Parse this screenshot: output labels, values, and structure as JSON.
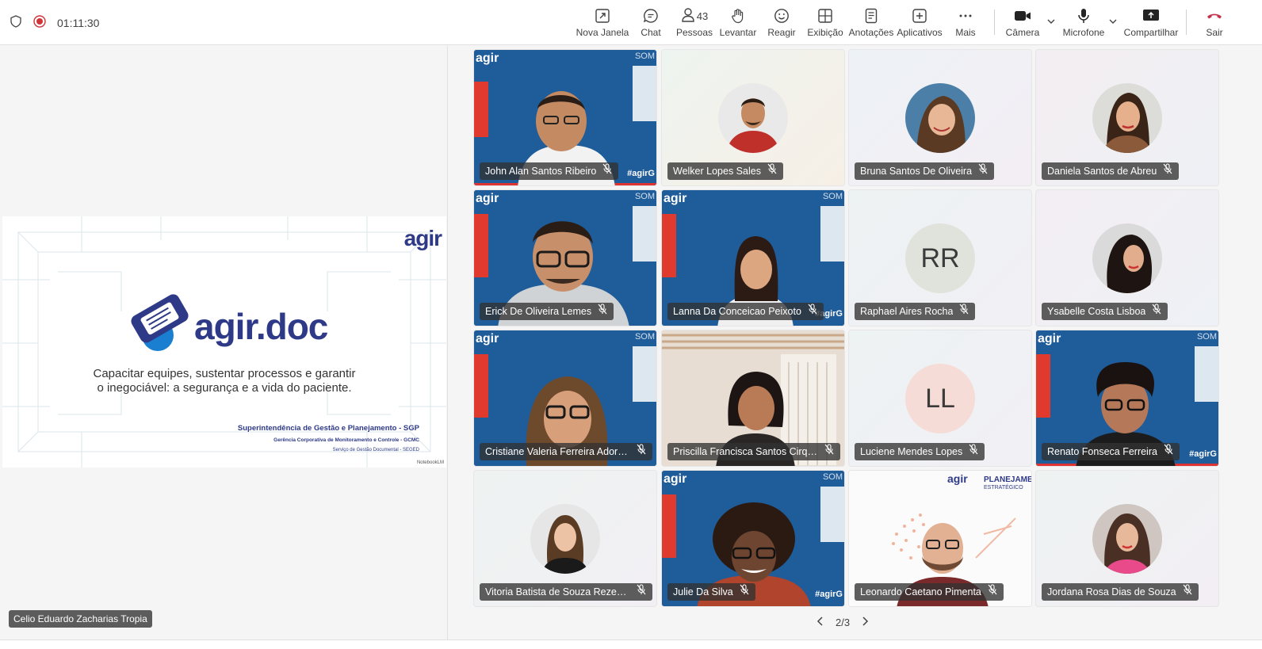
{
  "topbar": {
    "timer": "01:11:30",
    "buttons": {
      "nova_janela": "Nova Janela",
      "chat": "Chat",
      "pessoas": "Pessoas",
      "pessoas_count": "43",
      "levantar": "Levantar",
      "reagir": "Reagir",
      "exibicao": "Exibição",
      "anotacoes": "Anotações",
      "aplicativos": "Aplicativos",
      "mais": "Mais",
      "camera": "Câmera",
      "microfone": "Microfone",
      "compartilhar": "Compartilhar",
      "sair": "Sair"
    },
    "colors": {
      "leave": "#c4314b",
      "record": "#d13438"
    }
  },
  "slide": {
    "logo_small": "agir",
    "logo_big": "agir.doc",
    "tagline_1": "Capacitar equipes, sustentar processos e garantir",
    "tagline_2": "o inegociável: a segurança e a vida do paciente.",
    "org_1": "Superintendência de Gestão e Planejamento - SGP",
    "org_2": "Gerência Corporativa de Monitoramento e Controle - GCMC",
    "org_3": "Serviço de Gestão Documental - SEGED",
    "watermark": "NotebookLM",
    "colors": {
      "navy": "#2e3a87",
      "blue": "#1b7fd1"
    }
  },
  "presenter": "Celio Eduardo Zacharias Tropia",
  "participants": [
    {
      "name": "John Alan Santos Ribeiro",
      "kind": "video"
    },
    {
      "name": "Welker Lopes Sales",
      "kind": "photo"
    },
    {
      "name": "Bruna Santos De Oliveira",
      "kind": "photo"
    },
    {
      "name": "Daniela Santos de Abreu",
      "kind": "photo"
    },
    {
      "name": "Erick De Oliveira Lemes",
      "kind": "video"
    },
    {
      "name": "Lanna Da Conceicao Peixoto",
      "kind": "video"
    },
    {
      "name": "Raphael Aires Rocha",
      "kind": "initials",
      "initials": "RR"
    },
    {
      "name": "Ysabelle Costa Lisboa",
      "kind": "photo"
    },
    {
      "name": "Cristiane Valeria Ferreira Adorn...",
      "kind": "video"
    },
    {
      "name": "Priscilla Francisca Santos Cirqu...",
      "kind": "video-room"
    },
    {
      "name": "Luciene Mendes Lopes",
      "kind": "initials",
      "initials": "LL"
    },
    {
      "name": "Renato Fonseca Ferreira",
      "kind": "video"
    },
    {
      "name": "Vitoria Batista de Souza Rezende",
      "kind": "photo"
    },
    {
      "name": "Julie Da Silva",
      "kind": "video"
    },
    {
      "name": "Leonardo Caetano Pimenta",
      "kind": "video-bg"
    },
    {
      "name": "Jordana Rosa Dias de Souza",
      "kind": "photo"
    }
  ],
  "pager": "2/3",
  "background_labels": {
    "hashtag": "#agirG",
    "som": "SOM",
    "agir_bg": "agir",
    "planejamento": "PLANEJAMENT",
    "estrategico": "ESTRATÉGICO"
  }
}
